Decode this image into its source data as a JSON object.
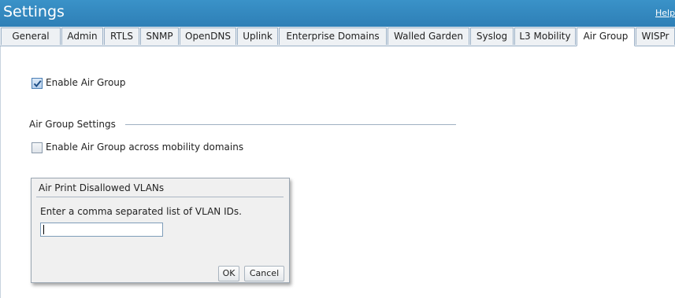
{
  "header": {
    "title": "Settings",
    "help_label": "Help"
  },
  "tabs": [
    {
      "label": "General"
    },
    {
      "label": "Admin"
    },
    {
      "label": "RTLS"
    },
    {
      "label": "SNMP"
    },
    {
      "label": "OpenDNS"
    },
    {
      "label": "Uplink"
    },
    {
      "label": "Enterprise Domains"
    },
    {
      "label": "Walled Garden"
    },
    {
      "label": "Syslog"
    },
    {
      "label": "L3 Mobility"
    },
    {
      "label": "Air Group",
      "active": true
    },
    {
      "label": "WISPr"
    }
  ],
  "air_group": {
    "enable_label": "Enable Air Group",
    "enable_checked": true,
    "settings_heading": "Air Group Settings",
    "mobility_label": "Enable Air Group across mobility domains",
    "mobility_checked": false
  },
  "dialog": {
    "title": "Air Print Disallowed VLANs",
    "message": "Enter a comma separated list of VLAN IDs.",
    "input_value": "",
    "ok_label": "OK",
    "cancel_label": "Cancel"
  },
  "colors": {
    "header_bg": "#2e7fb6",
    "tab_border": "#9fb3c8",
    "dialog_bg": "#f0f0f0"
  }
}
